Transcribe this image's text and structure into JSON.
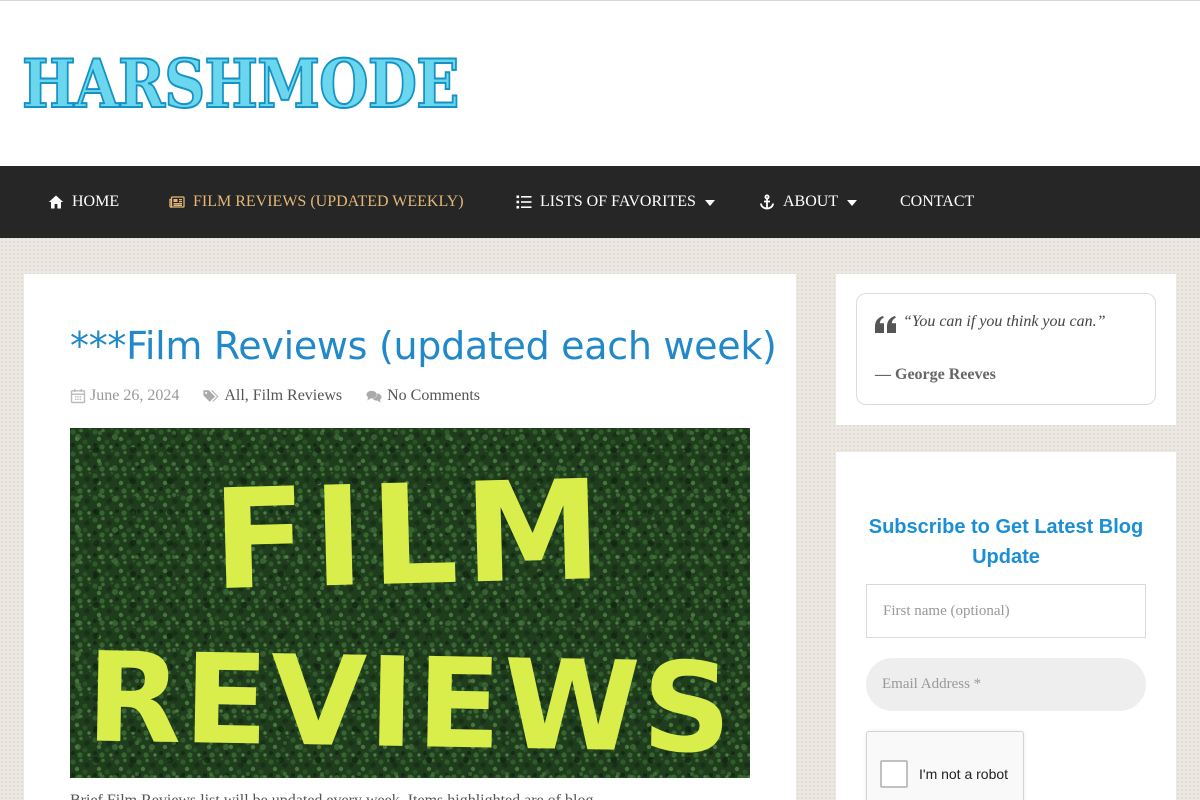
{
  "site": {
    "logo_text": "HARSHMODE"
  },
  "nav": {
    "items": [
      {
        "label": "HOME",
        "icon": "home-icon"
      },
      {
        "label": "FILM REVIEWS (UPDATED WEEKLY)",
        "icon": "newspaper-icon",
        "active": true
      },
      {
        "label": "LISTS OF FAVORITES",
        "icon": "list-icon",
        "dropdown": true
      },
      {
        "label": "ABOUT",
        "icon": "anchor-icon",
        "dropdown": true
      },
      {
        "label": "CONTACT"
      }
    ]
  },
  "post": {
    "title": "***Film Reviews (updated each week)",
    "date": "June 26, 2024",
    "categories": [
      "All",
      "Film Reviews"
    ],
    "category_separator": ",",
    "comments": "No Comments",
    "featured_image": {
      "line1": "FILM",
      "line2": "REVIEWS"
    },
    "excerpt": "Brief Film Reviews list will be updated every week. Items highlighted are of blog"
  },
  "sidebar": {
    "quote": {
      "text": "“You can if you think you can.”",
      "author": "— George Reeves"
    },
    "subscribe": {
      "title": "Subscribe to Get Latest Blog Update",
      "first_name_placeholder": "First name (optional)",
      "email_placeholder": "Email Address *",
      "captcha_label": "I'm not a robot"
    }
  },
  "colors": {
    "accent_link": "#2188c9",
    "nav_active": "#e3b877",
    "nav_bg": "#262626",
    "subscribe_title": "#1b8fd6",
    "poster_text": "#d9ee4a",
    "poster_bg": "#1c3a1a"
  }
}
